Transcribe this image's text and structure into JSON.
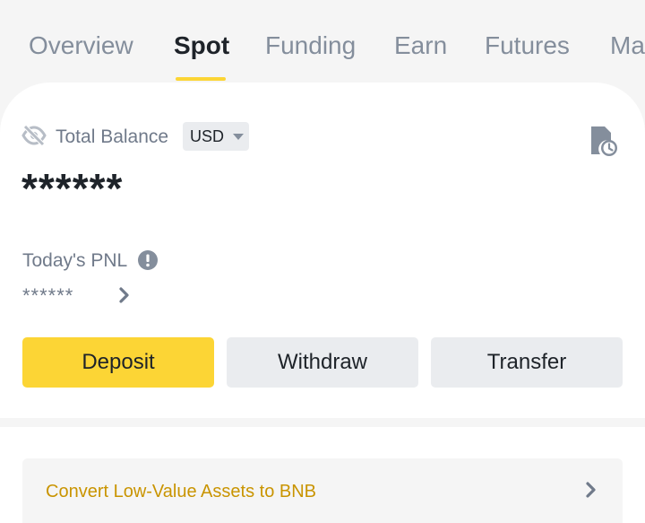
{
  "tabs": [
    {
      "label": "Overview"
    },
    {
      "label": "Spot"
    },
    {
      "label": "Funding"
    },
    {
      "label": "Earn"
    },
    {
      "label": "Futures"
    },
    {
      "label": "Ma"
    }
  ],
  "active_tab": "Spot",
  "balance": {
    "label": "Total Balance",
    "currency": "USD",
    "value": "******"
  },
  "pnl": {
    "label": "Today's PNL",
    "value": "******"
  },
  "actions": {
    "deposit": "Deposit",
    "withdraw": "Withdraw",
    "transfer": "Transfer"
  },
  "convert": {
    "label": "Convert Low-Value Assets to BNB"
  },
  "colors": {
    "accent": "#fcd535",
    "link": "#c99400",
    "text_primary": "#1e2329",
    "text_secondary": "#707a8a",
    "background": "#f5f5f5"
  },
  "icons": [
    "eye-hidden-icon",
    "caret-down-icon",
    "history-icon",
    "info-icon",
    "chevron-right-icon"
  ]
}
